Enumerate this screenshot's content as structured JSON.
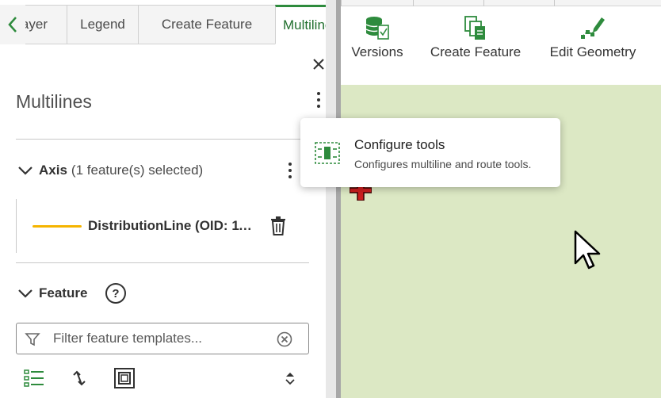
{
  "tabs": [
    {
      "label": "ayer",
      "active": false
    },
    {
      "label": "Legend",
      "active": false
    },
    {
      "label": "Create Feature",
      "active": false
    },
    {
      "label": "Multilines",
      "active": true
    }
  ],
  "panel": {
    "title": "Multilines"
  },
  "axis": {
    "title": "Axis",
    "selection_text": "(1 feature(s) selected)",
    "feature_label": "DistributionLine (OID: 11...",
    "line_color": "#f5b400"
  },
  "feature_section": {
    "title": "Feature",
    "help_label": "?",
    "filter_placeholder": "Filter feature templates..."
  },
  "ribbon": {
    "buttons": [
      {
        "label": "Versions",
        "icon": "versions-database-icon"
      },
      {
        "label": "Create Feature",
        "icon": "create-feature-icon"
      },
      {
        "label": "Edit Geometry",
        "icon": "edit-geometry-icon"
      }
    ]
  },
  "popup": {
    "title": "Configure tools",
    "description": "Configures multiline and route tools.",
    "icon": "configure-tools-icon"
  },
  "colors": {
    "accent_green": "#2e8b3d",
    "map_background": "#dce8c4",
    "line_swatch": "#f5b400",
    "marker_red": "#cc1f1f"
  }
}
